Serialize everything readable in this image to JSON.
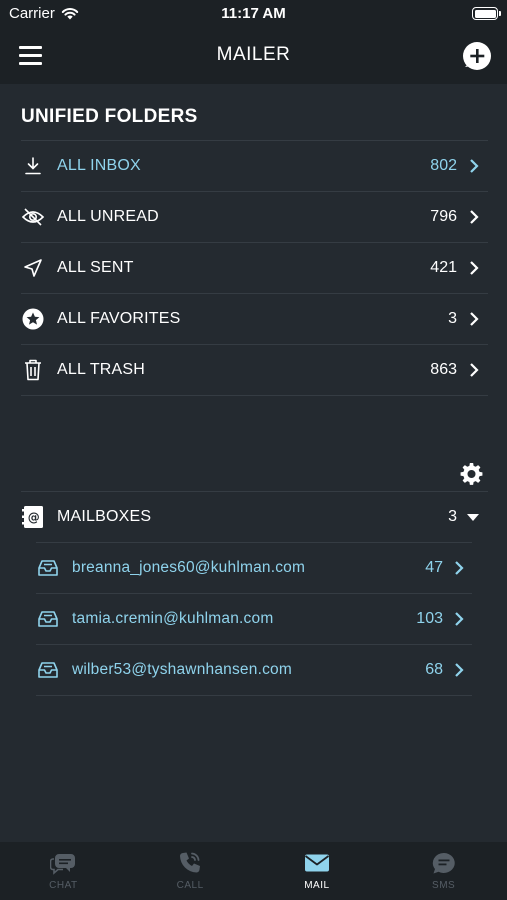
{
  "status_bar": {
    "carrier": "Carrier",
    "time": "11:17 AM",
    "battery_level": 1.0
  },
  "nav": {
    "title": "MAILER"
  },
  "unified": {
    "title": "UNIFIED FOLDERS",
    "folders": [
      {
        "label": "ALL INBOX",
        "count": "802",
        "icon": "download-icon",
        "highlighted": true
      },
      {
        "label": "ALL UNREAD",
        "count": "796",
        "icon": "eye-slash-icon"
      },
      {
        "label": "ALL SENT",
        "count": "421",
        "icon": "paper-plane-icon"
      },
      {
        "label": "ALL FAVORITES",
        "count": "3",
        "icon": "star-circle-icon"
      },
      {
        "label": "ALL TRASH",
        "count": "863",
        "icon": "trash-icon"
      }
    ]
  },
  "mailboxes": {
    "label": "MAILBOXES",
    "count": "3",
    "items": [
      {
        "email": "breanna_jones60@kuhlman.com",
        "count": "47"
      },
      {
        "email": "tamia.cremin@kuhlman.com",
        "count": "103"
      },
      {
        "email": "wilber53@tyshawnhansen.com",
        "count": "68"
      }
    ]
  },
  "tabs": [
    {
      "label": "CHAT",
      "icon": "chat-icon"
    },
    {
      "label": "CALL",
      "icon": "phone-icon"
    },
    {
      "label": "MAIL",
      "icon": "envelope-icon",
      "active": true
    },
    {
      "label": "SMS",
      "icon": "sms-icon"
    }
  ],
  "colors": {
    "accent": "#8fd3ec",
    "background": "#242a30",
    "bar": "#1c2125",
    "divider": "#353c43",
    "inactive_tab": "#555d65"
  }
}
